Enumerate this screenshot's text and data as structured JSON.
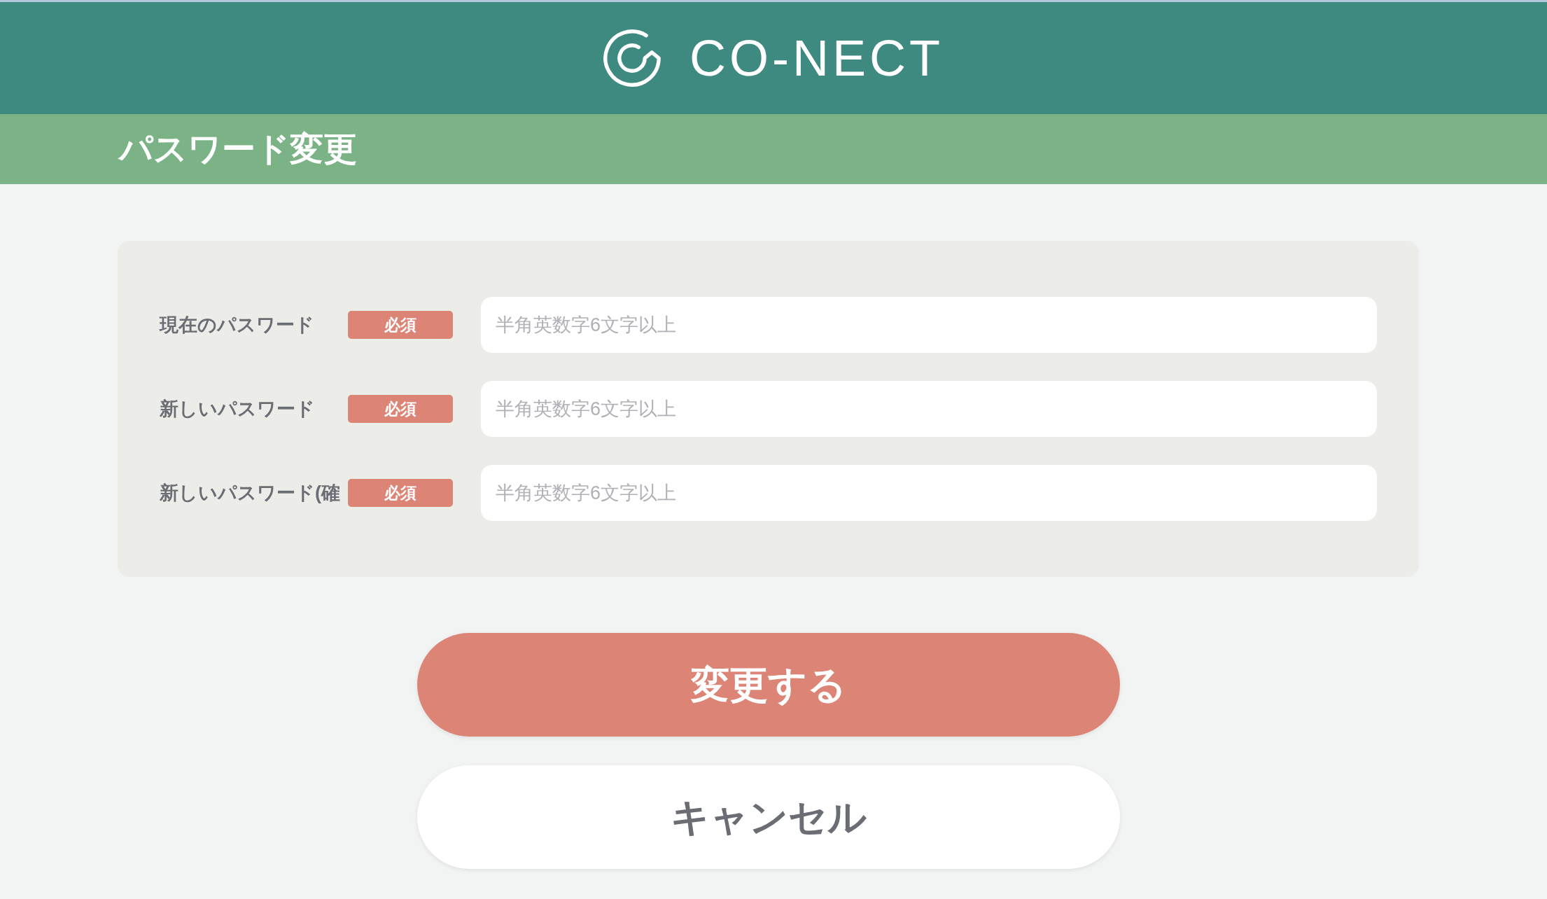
{
  "header": {
    "logo_text": "CO-NECT"
  },
  "page_title": "パスワード変更",
  "form": {
    "fields": [
      {
        "label": "現在のパスワード",
        "badge": "必須",
        "placeholder": "半角英数字6文字以上"
      },
      {
        "label": "新しいパスワード",
        "badge": "必須",
        "placeholder": "半角英数字6文字以上"
      },
      {
        "label": "新しいパスワード(確",
        "badge": "必須",
        "placeholder": "半角英数字6文字以上"
      }
    ]
  },
  "buttons": [
    {
      "label": "変更する",
      "kind": "primary"
    },
    {
      "label": "キャンセル",
      "kind": "secondary"
    }
  ]
}
